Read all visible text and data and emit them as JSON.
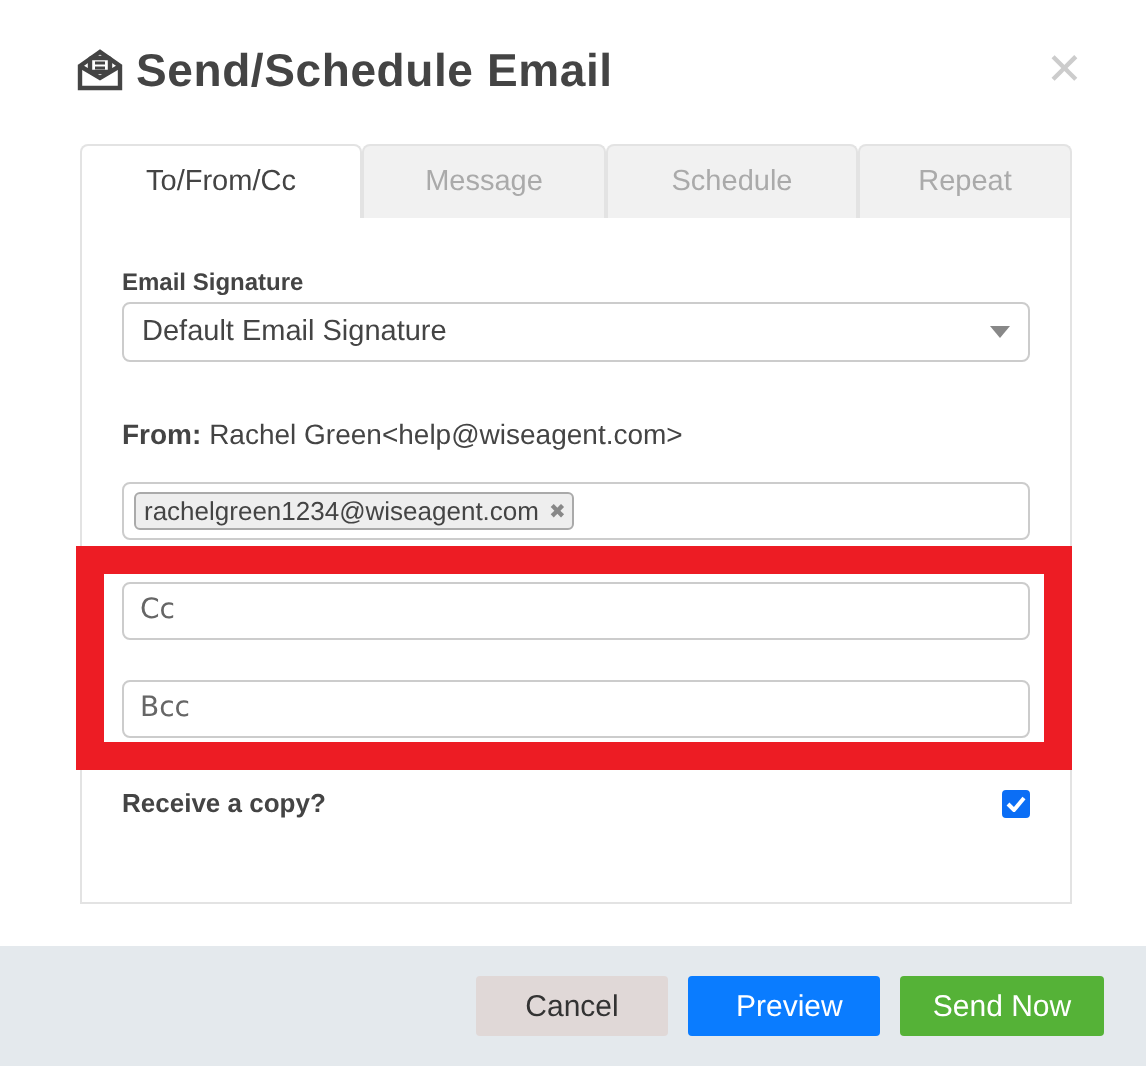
{
  "dialog": {
    "title": "Send/Schedule Email",
    "close": "✕"
  },
  "tabs": [
    {
      "label": "To/From/Cc",
      "selected": true
    },
    {
      "label": "Message",
      "selected": false
    },
    {
      "label": "Schedule",
      "selected": false
    },
    {
      "label": "Repeat",
      "selected": false
    }
  ],
  "signature": {
    "label": "Email Signature",
    "value": "Default Email Signature"
  },
  "from": {
    "label": "From:",
    "value": "Rachel Green<help@wiseagent.com>"
  },
  "to": {
    "tags": [
      {
        "label": "rachelgreen1234@wiseagent.com",
        "remove": "✖"
      }
    ]
  },
  "cc": {
    "placeholder": "Cc"
  },
  "bcc": {
    "placeholder": "Bcc"
  },
  "receive_copy": {
    "label": "Receive a copy?",
    "checked": true
  },
  "buttons": [
    {
      "label": "Cancel",
      "kind": "cancel"
    },
    {
      "label": "Preview",
      "kind": "primary"
    },
    {
      "label": "Send Now",
      "kind": "success"
    }
  ]
}
